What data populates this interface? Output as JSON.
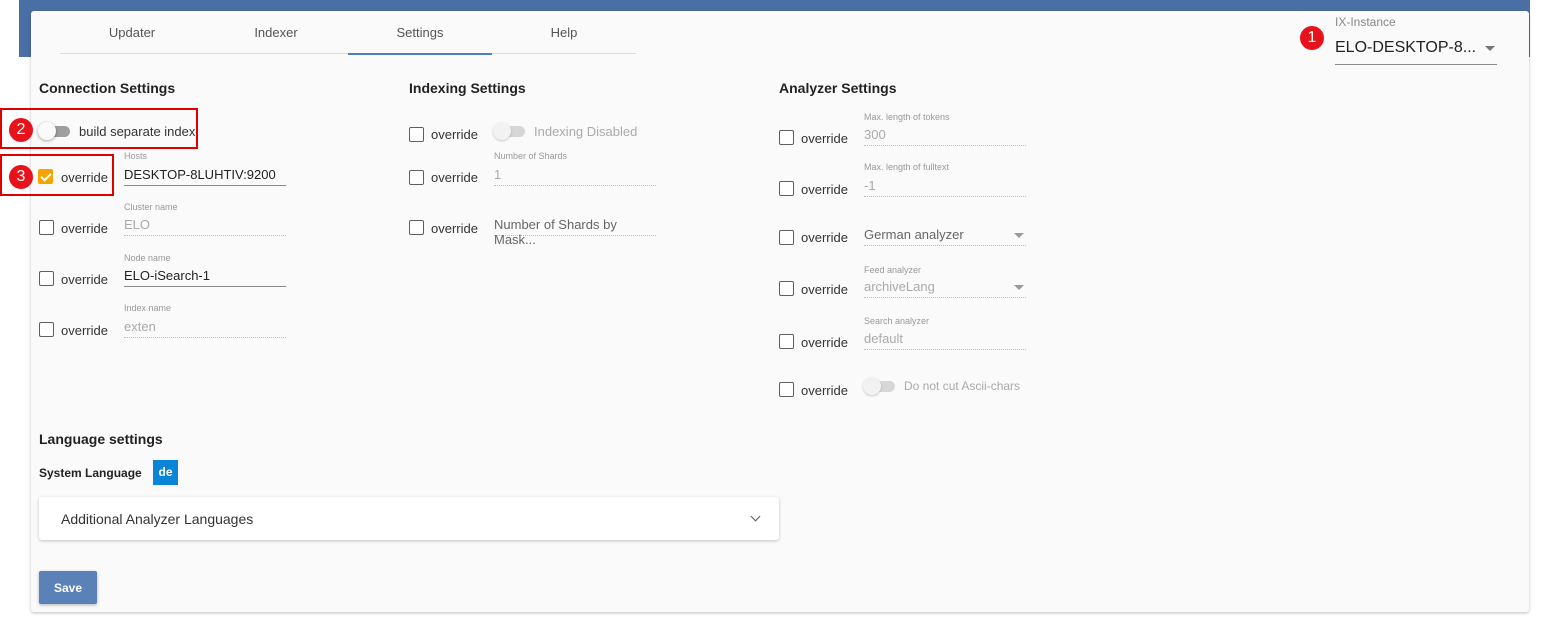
{
  "tabs": [
    "Updater",
    "Indexer",
    "Settings",
    "Help"
  ],
  "instance": {
    "label": "IX-Instance",
    "value": "ELO-DESKTOP-8..."
  },
  "override_label": "override",
  "badges": [
    "1",
    "2",
    "3"
  ],
  "connection": {
    "title": "Connection Settings",
    "separate_index_label": "build separate index",
    "hosts": {
      "label": "Hosts",
      "value": "DESKTOP-8LUHTIV:9200",
      "checked": true
    },
    "cluster": {
      "label": "Cluster name",
      "value": "ELO"
    },
    "node": {
      "label": "Node name",
      "value": "ELO-iSearch-1"
    },
    "index": {
      "label": "Index name",
      "value": "exten"
    }
  },
  "indexing": {
    "title": "Indexing Settings",
    "disabled_label": "Indexing Disabled",
    "shards": {
      "label": "Number of Shards",
      "value": "1"
    },
    "shards_mask": {
      "value": "Number of Shards by Mask..."
    }
  },
  "analyzer": {
    "title": "Analyzer Settings",
    "max_tokens": {
      "label": "Max. length of tokens",
      "value": "300"
    },
    "max_fulltext": {
      "label": "Max. length of fulltext",
      "value": "-1"
    },
    "analyzer": {
      "value": "German analyzer"
    },
    "feed": {
      "label": "Feed analyzer",
      "value": "archiveLang"
    },
    "search": {
      "label": "Search analyzer",
      "value": "default"
    },
    "ascii_label": "Do not cut Ascii-chars"
  },
  "language": {
    "title": "Language settings",
    "system_label": "System Language",
    "system_value": "de",
    "additional_label": "Additional Analyzer Languages"
  },
  "save_label": "Save",
  "colors": {
    "header": "#4a6fa5",
    "accent": "#f5a300",
    "save": "#5b82b8",
    "chip": "#0a84d6",
    "badge": "#e8121a"
  }
}
